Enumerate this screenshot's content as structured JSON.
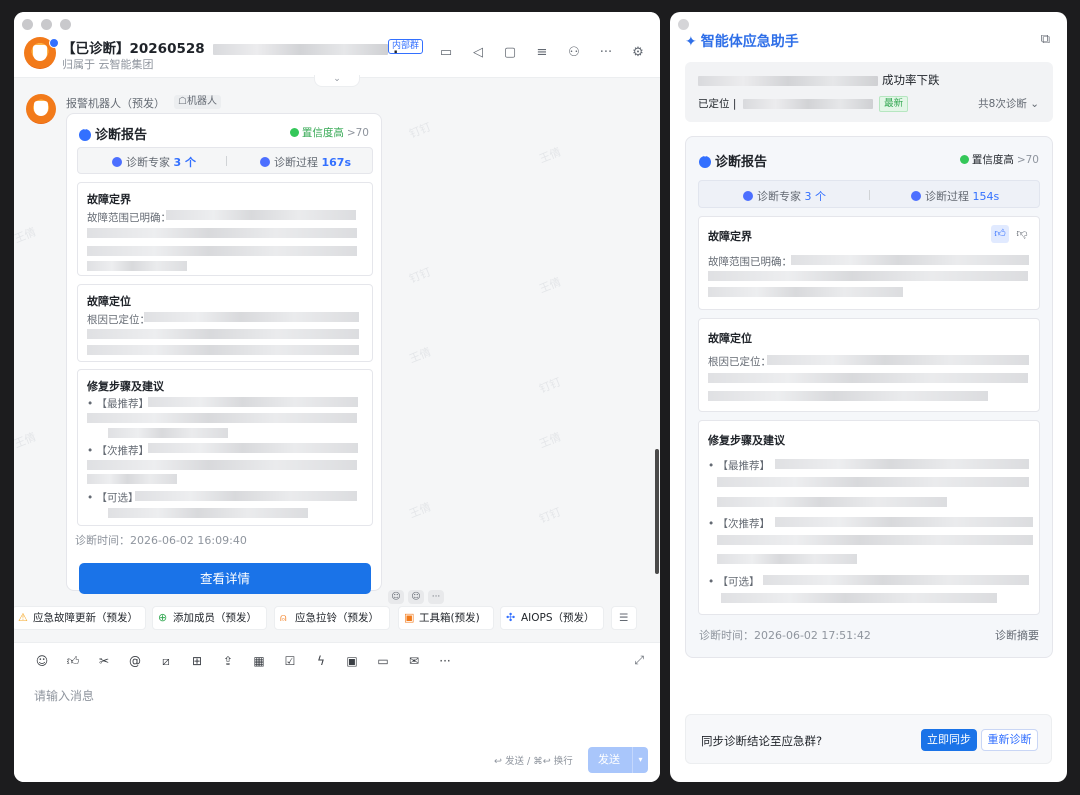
{
  "left_window": {
    "header": {
      "title_prefix": "【已诊断】20260528",
      "title_suffix": ".",
      "internal_tag": "内部群",
      "subtitle": "归属于 云智能集团",
      "tools": [
        "video-icon",
        "speaker-icon",
        "folder-icon",
        "search-doc-icon",
        "add-member-icon",
        "more-icon",
        "settings-icon"
      ]
    },
    "message": {
      "sender": "报警机器人（预发）",
      "robot_tag": "机器人",
      "card": {
        "title": "诊断报告",
        "confidence_label": "置信度高",
        "confidence_value": ">70",
        "experts_label": "诊断专家",
        "experts_value": "3 个",
        "process_label": "诊断过程",
        "process_value": "167s",
        "sections": [
          {
            "title": "故障定界",
            "line": "故障范围已明确："
          },
          {
            "title": "故障定位",
            "line": "根因已定位："
          },
          {
            "title": "修复步骤及建议",
            "items": [
              "• 【最推荐】",
              "• 【次推荐】",
              "• 【可选】"
            ]
          }
        ],
        "time": "诊断时间：2026-06-02 16:09:40",
        "detail_button": "查看详情"
      }
    },
    "quick_actions": [
      {
        "label": "应急故障更新（预发）",
        "icon": "warning-icon"
      },
      {
        "label": "添加成员（预发）",
        "icon": "add-circle-icon"
      },
      {
        "label": "应急拉铃（预发）",
        "icon": "bell-icon"
      },
      {
        "label": "工具箱(预发)",
        "icon": "toolbox-icon"
      },
      {
        "label": "AIOPS（预发）",
        "icon": "aiops-icon"
      }
    ],
    "composer": {
      "placeholder": "请输入消息",
      "send_hint": "↩ 发送 / ⌘↩ 换行",
      "send_label": "发送"
    },
    "watermark": [
      "钉钉",
      "王倩"
    ]
  },
  "right_window": {
    "title": "智能体应急助手",
    "summary": {
      "line1_suffix": "成功率下跌",
      "line2_prefix": "已定位 |",
      "new_tag": "最新",
      "more": "共8次诊断"
    },
    "card": {
      "title": "诊断报告",
      "confidence_label": "置信度高",
      "confidence_value": ">70",
      "experts_label": "诊断专家",
      "experts_value": "3 个",
      "process_label": "诊断过程",
      "process_value": "154s",
      "sections": [
        {
          "title": "故障定界",
          "line": "故障范围已明确："
        },
        {
          "title": "故障定位",
          "line": "根因已定位："
        },
        {
          "title": "修复步骤及建议",
          "items": [
            "• 【最推荐】",
            "• 【次推荐】",
            "• 【可选】"
          ]
        }
      ],
      "time": "诊断时间：2026-06-02 17:51:42",
      "summary_link": "诊断摘要"
    },
    "sync": {
      "question": "同步诊断结论至应急群?",
      "sync_button": "立即同步",
      "redo_button": "重新诊断"
    }
  }
}
